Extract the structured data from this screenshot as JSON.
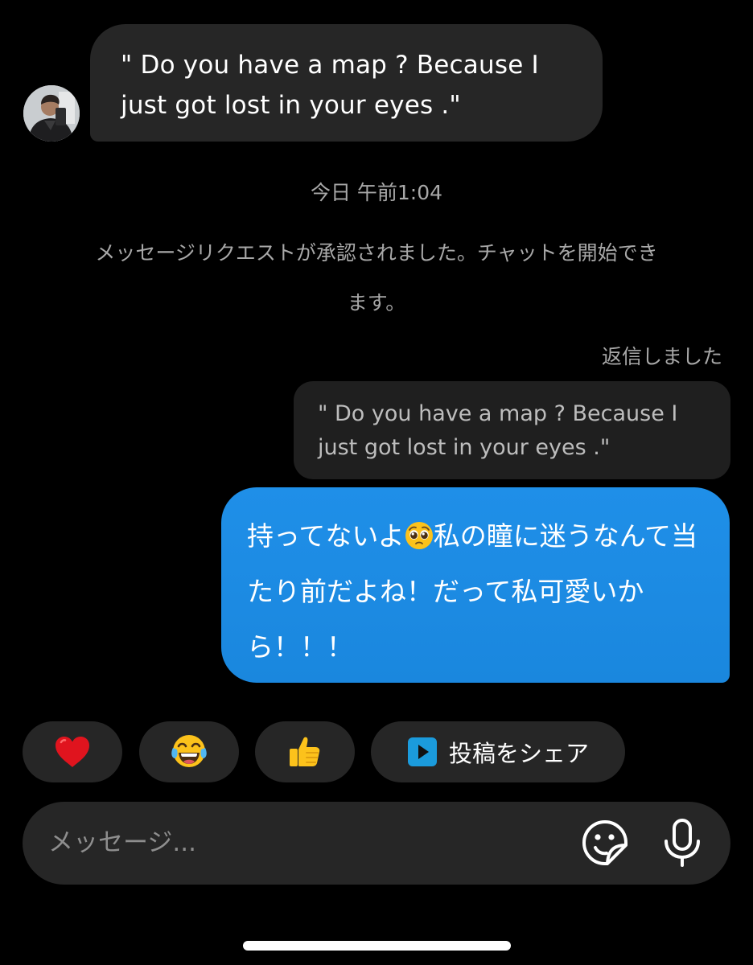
{
  "incoming": {
    "text": "\" Do you have a map ? Because I just got lost in your eyes .\""
  },
  "divider": {
    "timestamp": "今日 午前1:04",
    "system_message": "メッセージリクエストが承認されました。チャットを開始できます。"
  },
  "reply": {
    "label": "返信しました",
    "quoted_text": "\" Do you have a map ? Because I just got lost in your eyes .\"",
    "text_before_emoji": "持ってないよ",
    "emoji": "pleading-face-emoji",
    "text_after_emoji": "私の瞳に迷うなんて当たり前だよね！だって私可愛いから！！！",
    "bubble_color": "#1a8ae2"
  },
  "quick_replies": {
    "heart": "red-heart-emoji",
    "joy": "tears-of-joy-emoji",
    "thumbs": "thumbs-up-emoji",
    "share_icon": "play-icon",
    "share_label": "投稿をシェア"
  },
  "composer": {
    "placeholder": "メッセージ...",
    "sticker_icon": "sticker-icon",
    "mic_icon": "microphone-icon"
  }
}
